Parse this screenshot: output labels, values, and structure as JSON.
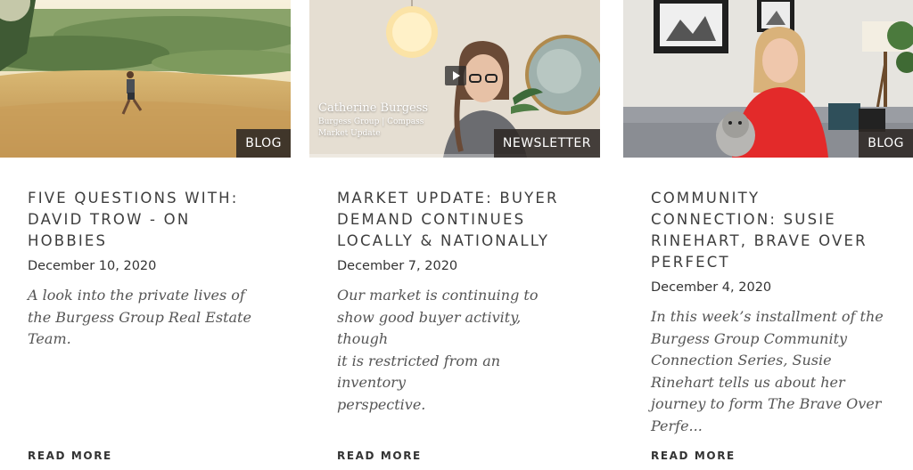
{
  "cards": [
    {
      "tag": "BLOG",
      "title_lines": [
        "FIVE QUESTIONS WITH:",
        "DAVID TROW - ON",
        "HOBBIES"
      ],
      "date": "December 10, 2020",
      "excerpt_lines": [
        "A look into the private lives of",
        "the Burgess Group Real Estate",
        "Team."
      ],
      "read_more": "READ MORE"
    },
    {
      "tag": "NEWSLETTER",
      "title_lines": [
        "MARKET UPDATE: BUYER",
        "DEMAND CONTINUES",
        "LOCALLY & NATIONALLY"
      ],
      "date": "December 7, 2020",
      "excerpt_lines": [
        "Our market is continuing to",
        "show good buyer activity, though",
        "it is restricted from an inventory",
        "perspective."
      ],
      "read_more": "READ MORE",
      "video": {
        "name": "Catherine Burgess",
        "line1": "Burgess Group  |  Compass",
        "line2": "Market Update",
        "progress": 0.0
      }
    },
    {
      "tag": "BLOG",
      "title_lines": [
        "COMMUNITY",
        "CONNECTION: SUSIE",
        "RINEHART, BRAVE OVER",
        "PERFECT"
      ],
      "date": "December 4, 2020",
      "excerpt_lines": [
        "In this week’s installment of the",
        "Burgess Group Community",
        "Connection Series, Susie",
        "Rinehart tells us about her",
        "journey to form The Brave Over",
        "Perfe..."
      ],
      "read_more": "READ MORE"
    }
  ],
  "icons": {
    "play": "play-icon"
  },
  "colors": {
    "tag_bg": "#2d2824",
    "text": "#3d3d3d",
    "excerpt": "#555555"
  }
}
